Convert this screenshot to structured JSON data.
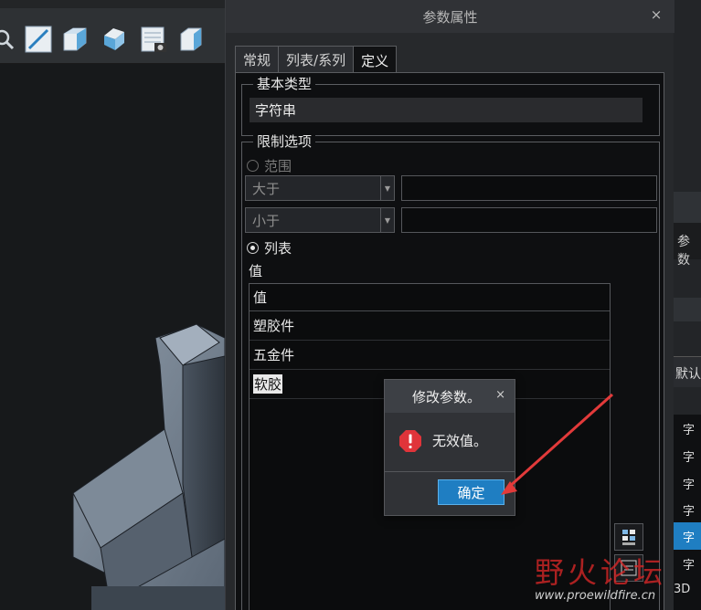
{
  "dialog": {
    "title": "参数属性",
    "close_glyph": "×",
    "tabs": [
      {
        "label": "常规"
      },
      {
        "label": "列表/系列"
      },
      {
        "label": "定义",
        "active": true
      }
    ],
    "basic_type": {
      "legend": "基本类型",
      "value": "字符串"
    },
    "limit_options": {
      "legend": "限制选项",
      "range_label": "范围",
      "greater_than": "大于",
      "less_than": "小于",
      "list_label": "列表",
      "values_label": "值"
    },
    "values_table": {
      "header": "值",
      "rows": [
        "塑胶件",
        "五金件",
        "软胶"
      ]
    }
  },
  "message_box": {
    "title": "修改参数。",
    "close_glyph": "×",
    "text": "无效值。",
    "ok_label": "确定",
    "icon": "error-icon"
  },
  "background": {
    "right_panel_texts": [
      "参数",
      "默认",
      "字",
      "字",
      "字",
      "字",
      "字",
      "字",
      "3D"
    ]
  },
  "watermark": {
    "text": "野火论坛",
    "url": "www.proewildfire.cn"
  },
  "colors": {
    "accent": "#1f7ec2",
    "error": "#e0343a",
    "arrow": "#e23a3a"
  }
}
